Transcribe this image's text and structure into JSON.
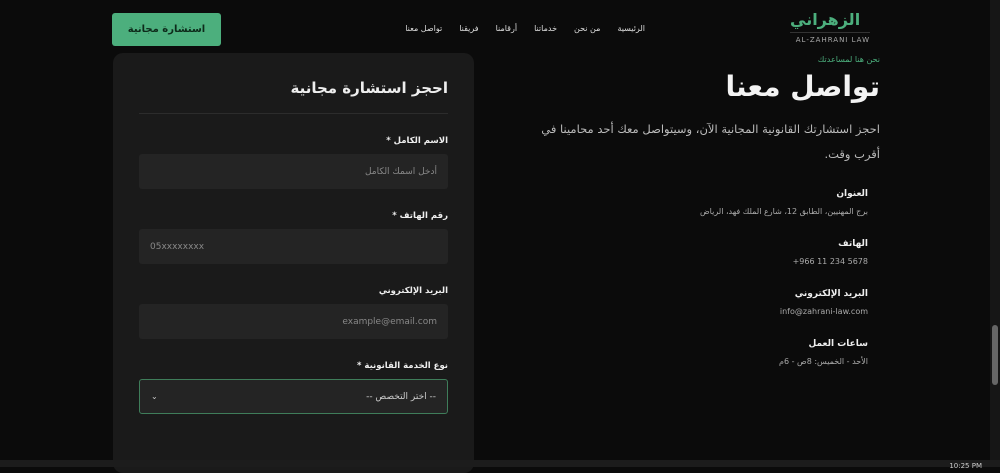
{
  "nav": {
    "cta": "استشارة مجانية",
    "items": [
      "الرئيسية",
      "من نحن",
      "خدماتنا",
      "أرقامنا",
      "فريقنا",
      "تواصل معنا"
    ],
    "logo_ar": "الزهراني",
    "logo_en": "AL-ZAHRANI LAW"
  },
  "contact": {
    "tag": "نحن هنا لمساعدتك",
    "title": "تواصل معنا",
    "lead": "احجز استشارتك القانونية المجانية الآن، وسيتواصل معك أحد محامينا في أقرب وقت.",
    "info": [
      {
        "t": "العنوان",
        "v": "برج المهنيين، الطابق 12، شارع الملك فهد، الرياض"
      },
      {
        "t": "الهاتف",
        "v": "+966 11 234 5678"
      },
      {
        "t": "البريد الإلكتروني",
        "v": "info@zahrani-law.com"
      },
      {
        "t": "ساعات العمل",
        "v": "الأحد - الخميس: 8ص - 6م"
      }
    ]
  },
  "form": {
    "title": "احجز استشارة مجانية",
    "name_label": "الاسم الكامل *",
    "name_ph": "أدخل اسمك الكامل",
    "phone_label": "رقم الهاتف *",
    "phone_ph": "05xxxxxxxx",
    "email_label": "البريد الإلكتروني",
    "email_ph": "example@email.com",
    "service_label": "نوع الخدمة القانونية *",
    "service_value": "-- اختر التخصص --"
  },
  "taskbar": {
    "time": "10:25 PM"
  }
}
